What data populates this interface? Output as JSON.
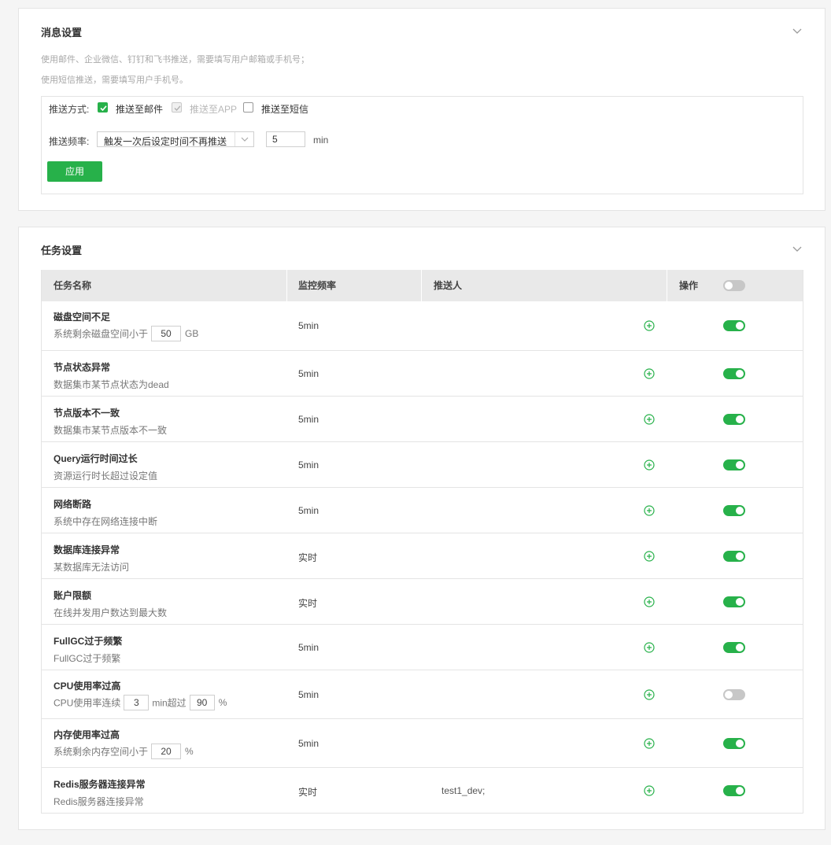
{
  "colors": {
    "accent": "#27b14a",
    "border": "#e4e4e4",
    "muted": "#a8a8a8"
  },
  "message_settings": {
    "title": "消息设置",
    "desc1": "使用邮件、企业微信、钉钉和飞书推送，需要填写用户邮箱或手机号；",
    "desc2": "使用短信推送，需要填写用户手机号。",
    "push_method_label": "推送方式:",
    "opt_email": "推送至邮件",
    "opt_email_checked": true,
    "opt_app": "推送至APP",
    "opt_app_checked": true,
    "opt_app_disabled": true,
    "opt_sms": "推送至短信",
    "opt_sms_checked": false,
    "freq_label": "推送频率:",
    "freq_select": "触发一次后设定时间不再推送",
    "freq_value": "5",
    "freq_unit": "min",
    "apply_label": "应用"
  },
  "task_settings": {
    "title": "任务设置",
    "columns": {
      "name": "任务名称",
      "freq": "监控频率",
      "pusher": "推送人",
      "ops": "操作"
    },
    "header_toggle_on": false,
    "rows": [
      {
        "name": "磁盘空间不足",
        "desc_pre": "系统剩余磁盘空间小于",
        "val1": "50",
        "unit1": "GB",
        "freq": "5min",
        "pusher": "",
        "enabled": true
      },
      {
        "name": "节点状态异常",
        "desc": "数据集市某节点状态为dead",
        "freq": "5min",
        "pusher": "",
        "enabled": true
      },
      {
        "name": "节点版本不一致",
        "desc": "数据集市某节点版本不一致",
        "freq": "5min",
        "pusher": "",
        "enabled": true
      },
      {
        "name": "Query运行时间过长",
        "desc": "资源运行时长超过设定值",
        "freq": "5min",
        "pusher": "",
        "enabled": true
      },
      {
        "name": "网络断路",
        "desc": "系统中存在网络连接中断",
        "freq": "5min",
        "pusher": "",
        "enabled": true
      },
      {
        "name": "数据库连接异常",
        "desc": "某数据库无法访问",
        "freq": "实时",
        "pusher": "",
        "enabled": true
      },
      {
        "name": "账户限额",
        "desc": "在线并发用户数达到最大数",
        "freq": "实时",
        "pusher": "",
        "enabled": true
      },
      {
        "name": "FullGC过于频繁",
        "desc": "FullGC过于频繁",
        "freq": "5min",
        "pusher": "",
        "enabled": true
      },
      {
        "name": "CPU使用率过高",
        "desc_pre": "CPU使用率连续",
        "val1": "3",
        "mid": "min超过",
        "val2": "90",
        "unit2": "%",
        "freq": "5min",
        "pusher": "",
        "enabled": false
      },
      {
        "name": "内存使用率过高",
        "desc_pre": "系统剩余内存空间小于",
        "val1": "20",
        "unit1": "%",
        "freq": "5min",
        "pusher": "",
        "enabled": true
      },
      {
        "name": "Redis服务器连接异常",
        "desc": "Redis服务器连接异常",
        "freq": "实时",
        "pusher": "test1_dev;",
        "enabled": true
      }
    ]
  }
}
